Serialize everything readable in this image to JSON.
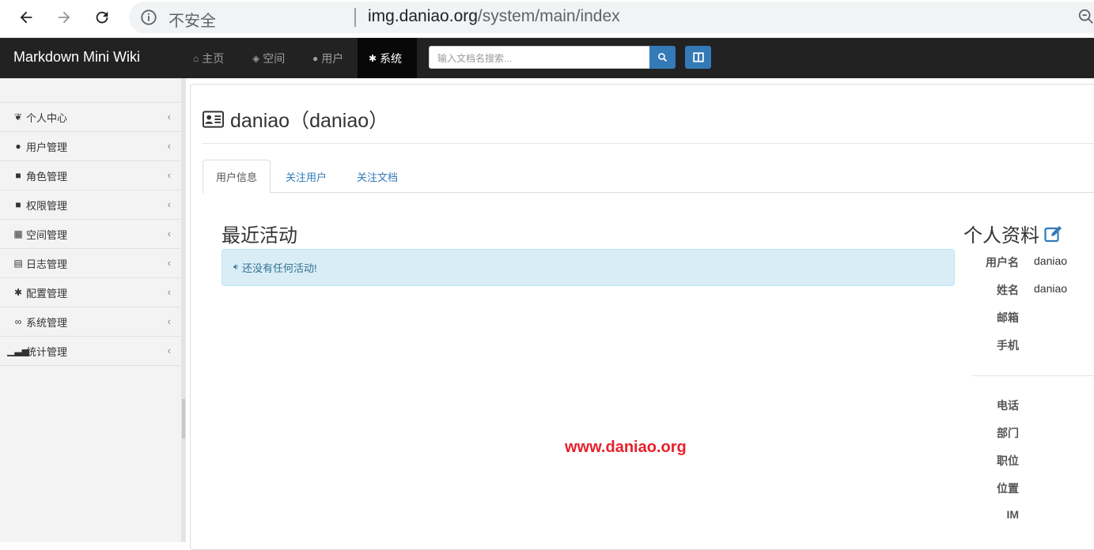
{
  "browser": {
    "insecure_label": "不安全",
    "url_host": "img.daniao.org",
    "url_path": "/system/main/index"
  },
  "navbar": {
    "brand": "Markdown Mini Wiki",
    "items": [
      {
        "label": "主页",
        "icon": "home-icon"
      },
      {
        "label": "空间",
        "icon": "cube-icon"
      },
      {
        "label": "用户",
        "icon": "user-icon"
      },
      {
        "label": "系统",
        "icon": "gear-icon",
        "active": true
      }
    ],
    "search_placeholder": "输入文档名搜索..."
  },
  "sidebar": {
    "items": [
      {
        "label": "个人中心",
        "icon": "leaf-icon"
      },
      {
        "label": "用户管理",
        "icon": "user-icon"
      },
      {
        "label": "角色管理",
        "icon": "users-icon"
      },
      {
        "label": "权限管理",
        "icon": "lock-icon"
      },
      {
        "label": "空间管理",
        "icon": "grid-icon"
      },
      {
        "label": "日志管理",
        "icon": "list-icon"
      },
      {
        "label": "配置管理",
        "icon": "gear-icon"
      },
      {
        "label": "系统管理",
        "icon": "link-icon"
      },
      {
        "label": "统计管理",
        "icon": "signal-icon"
      }
    ]
  },
  "main": {
    "title": "daniao（daniao）",
    "tabs": [
      {
        "label": "用户信息",
        "active": true
      },
      {
        "label": "关注用户"
      },
      {
        "label": "关注文档"
      }
    ],
    "activity_title": "最近活动",
    "activity_empty": "还没有任何活动!"
  },
  "profile": {
    "title": "个人资料",
    "fields": [
      {
        "label": "用户名",
        "value": "daniao"
      },
      {
        "label": "姓名",
        "value": "daniao"
      },
      {
        "label": "邮箱",
        "value": ""
      },
      {
        "label": "手机",
        "value": ""
      },
      {
        "label": "电话",
        "value": ""
      },
      {
        "label": "部门",
        "value": ""
      },
      {
        "label": "职位",
        "value": ""
      },
      {
        "label": "位置",
        "value": ""
      },
      {
        "label": "IM",
        "value": ""
      }
    ]
  },
  "watermark": "www.daniao.org",
  "colors": {
    "navbar_bg": "#222222",
    "primary": "#337ab7",
    "alert_bg": "#d9edf7",
    "watermark": "#e8202a"
  }
}
